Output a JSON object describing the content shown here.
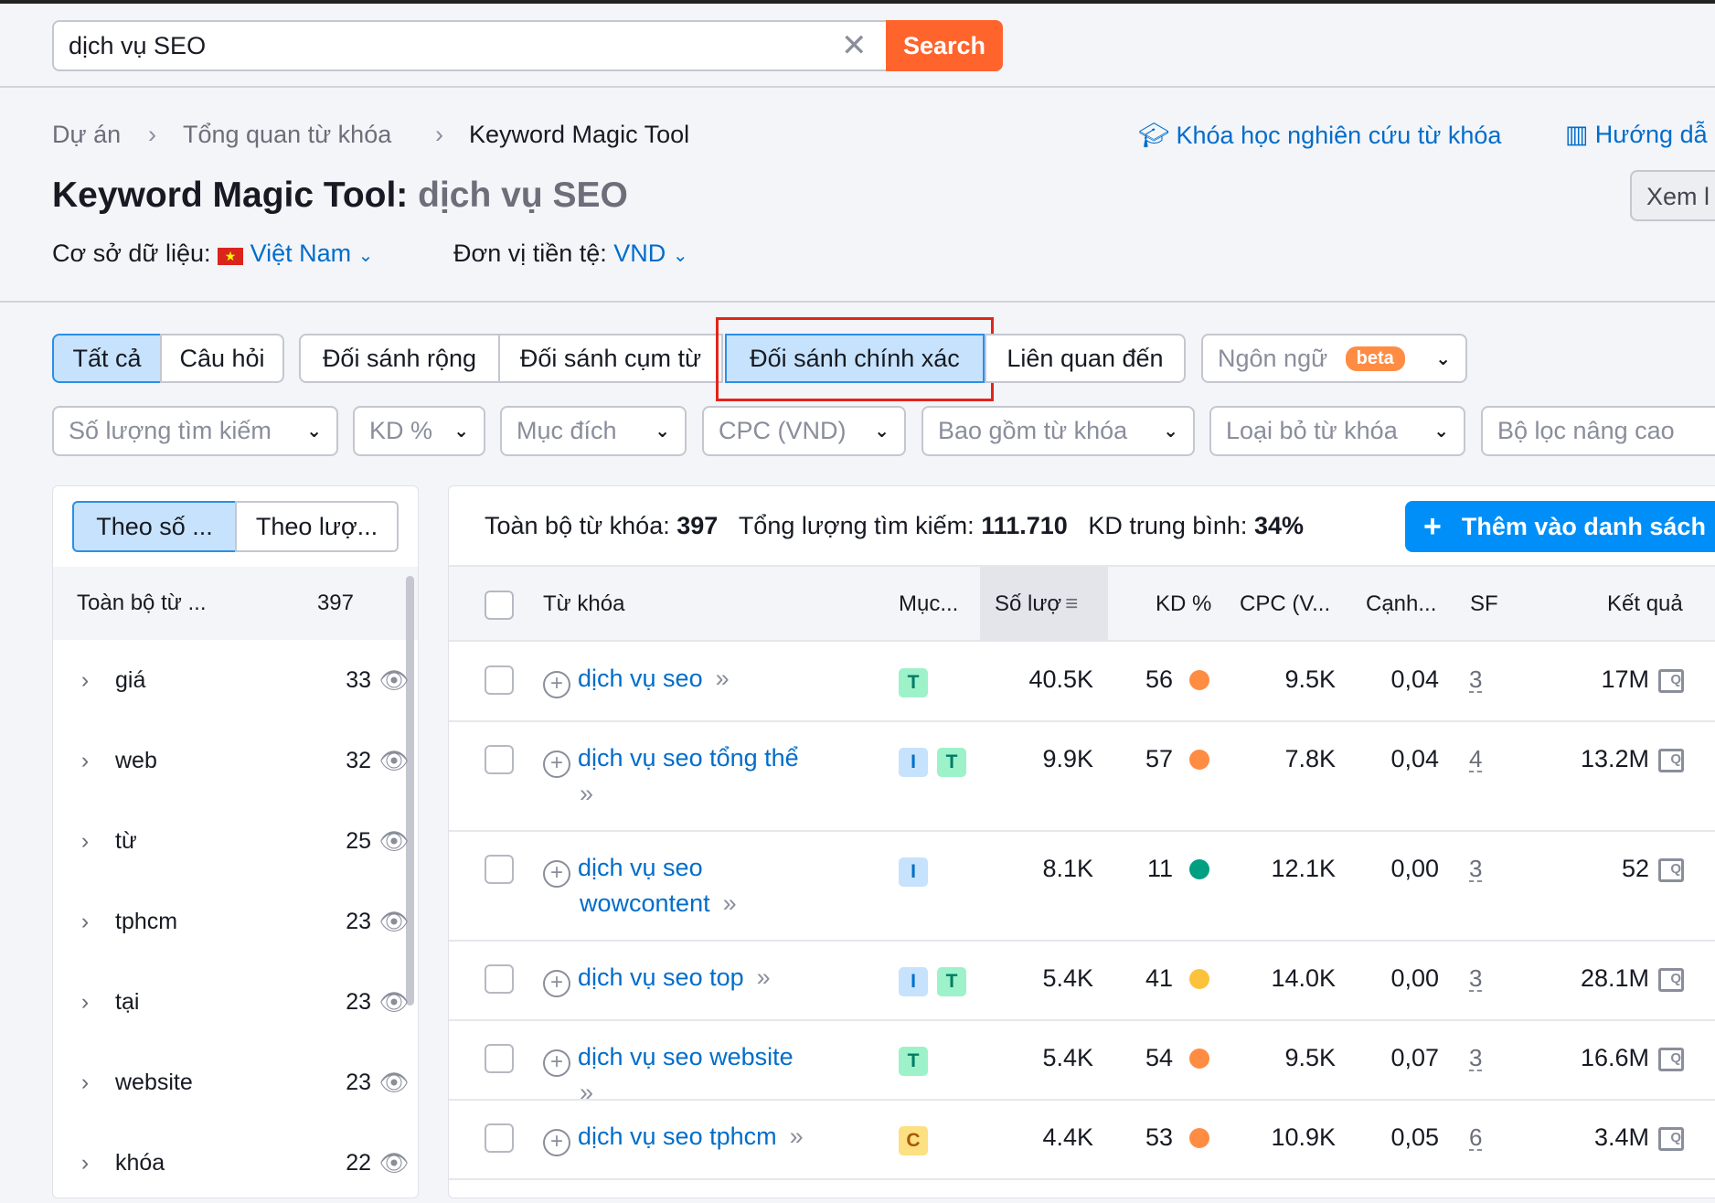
{
  "search": {
    "value": "dịch vụ SEO",
    "button": "Search"
  },
  "breadcrumb": [
    "Dự án",
    "Tổng quan từ khóa",
    "Keyword Magic Tool"
  ],
  "links": {
    "course": "Khóa học nghiên cứu từ khóa",
    "guide": "Hướng dẫ",
    "view": "Xem l"
  },
  "title": {
    "tool": "Keyword Magic Tool:",
    "keyword": "dịch vụ SEO"
  },
  "db": {
    "label": "Cơ sở dữ liệu:",
    "value": "Việt Nam",
    "currency_label": "Đơn vị tiền tệ:",
    "currency": "VND"
  },
  "tabs": [
    "Tất cả",
    "Câu hỏi",
    "Đối sánh rộng",
    "Đối sánh cụm từ",
    "Đối sánh chính xác",
    "Liên quan đến"
  ],
  "language": {
    "label": "Ngôn ngữ",
    "badge": "beta"
  },
  "filters": [
    "Số lượng tìm kiếm",
    "KD %",
    "Mục đích",
    "CPC (VND)",
    "Bao gồm từ khóa",
    "Loại bỏ từ khóa",
    "Bộ lọc nâng cao"
  ],
  "sidebar": {
    "toggle": [
      "Theo số ...",
      "Theo lượ..."
    ],
    "total_label": "Toàn bộ từ ...",
    "total": "397",
    "groups": [
      {
        "name": "giá",
        "count": "33"
      },
      {
        "name": "web",
        "count": "32"
      },
      {
        "name": "từ",
        "count": "25"
      },
      {
        "name": "tphcm",
        "count": "23"
      },
      {
        "name": "tại",
        "count": "23"
      },
      {
        "name": "website",
        "count": "23"
      },
      {
        "name": "khóa",
        "count": "22"
      }
    ]
  },
  "summary": {
    "total_label": "Toàn bộ từ khóa:",
    "total": "397",
    "volume_label": "Tổng lượng tìm kiếm:",
    "volume": "111.710",
    "kd_label": "KD trung bình:",
    "kd": "34%",
    "add_button": "Thêm vào danh sách"
  },
  "table": {
    "headers": [
      "Từ khóa",
      "Mục...",
      "Số lượ",
      "KD %",
      "CPC (V...",
      "Cạnh...",
      "SF",
      "Kết quả"
    ],
    "rows": [
      {
        "kw1": "dịch vụ seo",
        "kw2": "",
        "intent": [
          "T"
        ],
        "volume": "40.5K",
        "kd": "56",
        "kd_color": "#ff8c43",
        "cpc": "9.5K",
        "comp": "0,04",
        "sf": "3",
        "results": "17M"
      },
      {
        "kw1": "dịch vụ seo tổng thể",
        "kw2": "",
        "intent": [
          "I",
          "T"
        ],
        "volume": "9.9K",
        "kd": "57",
        "kd_color": "#ff8c43",
        "cpc": "7.8K",
        "comp": "0,04",
        "sf": "4",
        "results": "13.2M"
      },
      {
        "kw1": "dịch vụ seo",
        "kw2": "wowcontent",
        "intent": [
          "I"
        ],
        "volume": "8.1K",
        "kd": "11",
        "kd_color": "#009f81",
        "cpc": "12.1K",
        "comp": "0,00",
        "sf": "3",
        "results": "52"
      },
      {
        "kw1": "dịch vụ seo top",
        "kw2": "",
        "intent": [
          "I",
          "T"
        ],
        "volume": "5.4K",
        "kd": "41",
        "kd_color": "#fdc23c",
        "cpc": "14.0K",
        "comp": "0,00",
        "sf": "3",
        "results": "28.1M"
      },
      {
        "kw1": "dịch vụ seo website",
        "kw2": "",
        "intent": [
          "T"
        ],
        "volume": "5.4K",
        "kd": "54",
        "kd_color": "#ff8c43",
        "cpc": "9.5K",
        "comp": "0,07",
        "sf": "3",
        "results": "16.6M"
      },
      {
        "kw1": "dịch vụ seo tphcm",
        "kw2": "",
        "intent": [
          "C"
        ],
        "volume": "4.4K",
        "kd": "53",
        "kd_color": "#ff8c43",
        "cpc": "10.9K",
        "comp": "0,05",
        "sf": "6",
        "results": "3.4M"
      }
    ]
  }
}
